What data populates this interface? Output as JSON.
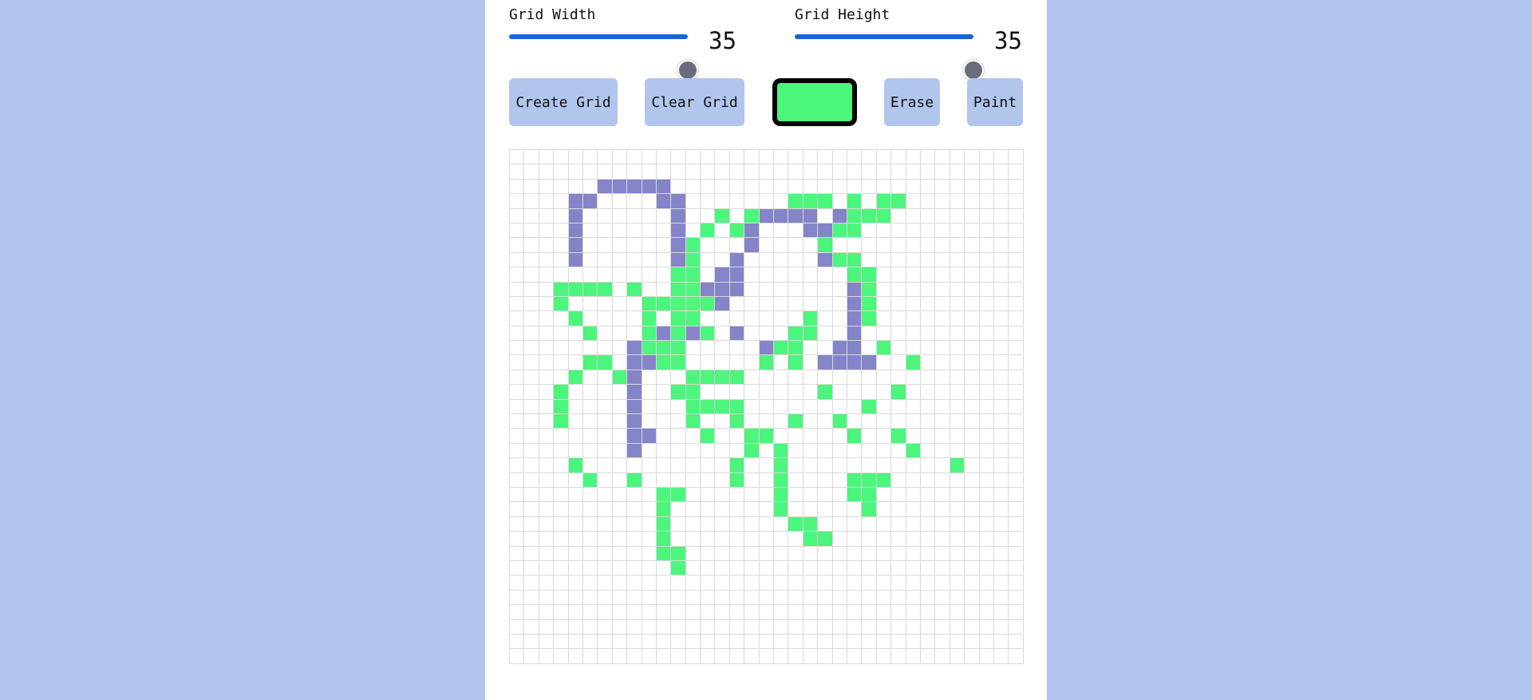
{
  "controls": {
    "grid_width": {
      "label": "Grid Width",
      "value": 35,
      "min": 1,
      "max": 35
    },
    "grid_height": {
      "label": "Grid Height",
      "value": 35,
      "min": 1,
      "max": 35
    }
  },
  "buttons": {
    "create_grid": "Create Grid",
    "clear_grid": "Clear Grid",
    "erase": "Erase",
    "paint": "Paint"
  },
  "colors": {
    "background": "#b1c5ed",
    "panel": "#ffffff",
    "selected_paint": "#4cf57c",
    "slider_track": "#1565d8",
    "cell_empty": "#ffffff",
    "cell_border": "#d9d9d9"
  },
  "grid": {
    "columns": 35,
    "rows": 35,
    "palette": {
      "g": "#4cf57c",
      "p": "#8584c8"
    },
    "cells": [
      "...................................",
      "...................................",
      "......ppppp........................",
      "....pp....pp.......ggg.g.gg........",
      "....p......p..g.gpppp.pggg.........",
      "....p......p.g.gp...ppgg...........",
      "....p......pg...p....g.............",
      "....p......pg..p.....pgg...........",
      "...........gg.pp.......gg..........",
      "...gggg.g..ggppp.......pg..........",
      "...g.....gggggp........pg..........",
      "....g....g.gg.......g..pg..........",
      ".....g...gpgpg.p...gg..p...........",
      "........pggg.....pgg..pp.g.........",
      ".....gg.ppgg.....g.g.pppp..g.......",
      "....g..gp...gggg...................",
      "...g....p..gg........g....g........",
      "...g....p...gggg........g..........",
      "...g....p...g..g...g..g............",
      "........pp...g..gg.....g..g........",
      "........p.......g.g........g.......",
      "....g..........g..g...........g....",
      ".....g..g......g..g....ggg.........",
      "..........gg......g....gg..........",
      "..........g.......g.....g..........",
      "..........g........gg..............",
      "..........g.........gg.............",
      "..........gg.......................",
      "...........g.......................",
      "...................................",
      "...................................",
      "...................................",
      "...................................",
      "...................................",
      "..................................."
    ]
  }
}
